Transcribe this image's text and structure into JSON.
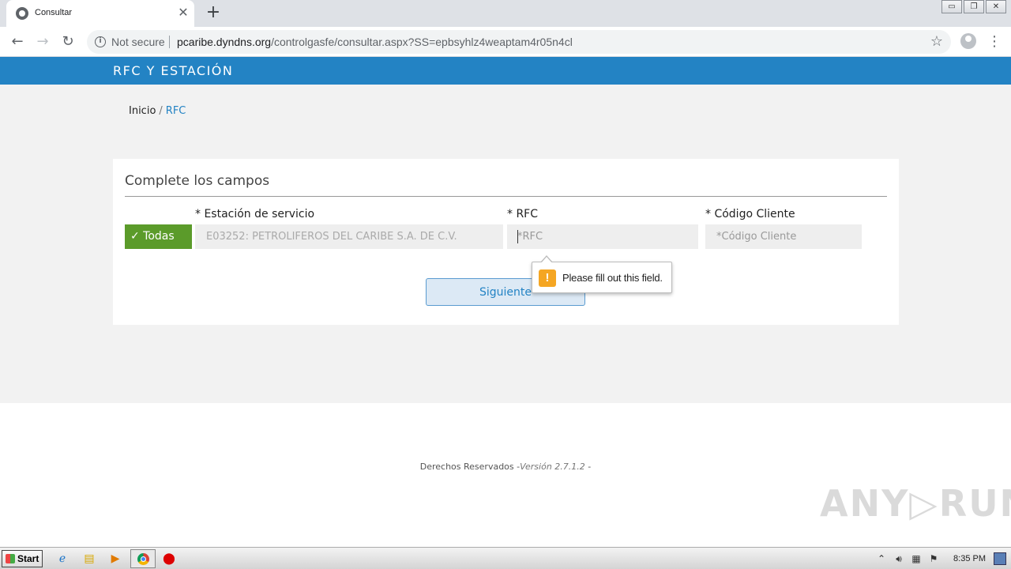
{
  "browser": {
    "tab_title": "Consultar",
    "tab_close": "✕",
    "new_tab": "+",
    "not_secure": "Not secure",
    "url_host": "pcaribe.dyndns.org",
    "url_path": "/controlgasfe/consultar.aspx?SS=epbsyhlz4weaptam4r05n4cl"
  },
  "page": {
    "banner_title": "RFC Y ESTACIÓN",
    "breadcrumb": {
      "home": "Inicio",
      "separator": "/",
      "current": "RFC"
    },
    "form": {
      "title": "Complete los campos",
      "estacion_label": "* Estación de servicio",
      "rfc_label": "* RFC",
      "codigo_label": "* Código Cliente",
      "todas_label": "✓ Todas",
      "estacion_value": "E03252: PETROLIFEROS DEL CARIBE S.A. DE C.V.",
      "rfc_placeholder": "*RFC",
      "codigo_placeholder": "*Código Cliente",
      "submit_label": "Siguiente",
      "validation_message": "Please fill out this field.",
      "validation_icon": "!"
    },
    "footer": {
      "rights": "Derechos Reservados -",
      "version": "Versión 2.7.1.2",
      "tail": " -"
    },
    "watermark": "ANY▷RUN"
  },
  "taskbar": {
    "start_label": "Start",
    "clock": "8:35 PM"
  },
  "colors": {
    "banner": "#2383c4",
    "todas": "#5b9b2a",
    "link": "#2383c4",
    "warning": "#f5a623"
  }
}
